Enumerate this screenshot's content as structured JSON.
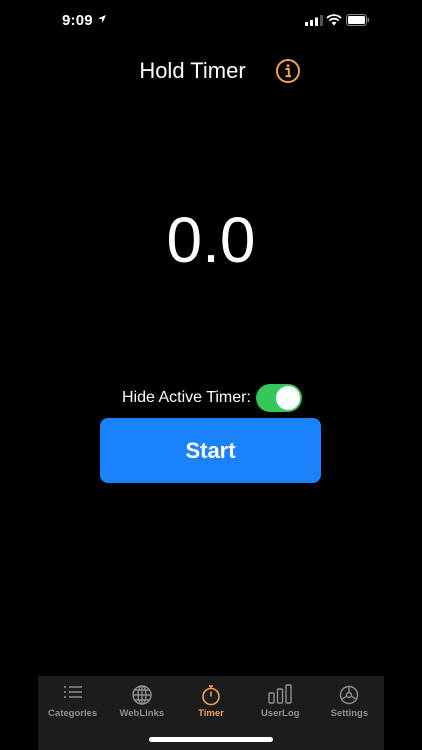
{
  "status_bar": {
    "time": "9:09"
  },
  "nav": {
    "title": "Hold Timer",
    "info_icon": "info-circle-icon"
  },
  "timer": {
    "display": "0.0"
  },
  "hide_timer": {
    "label": "Hide Active Timer:",
    "enabled": true
  },
  "start": {
    "label": "Start"
  },
  "tabs": [
    {
      "label": "Categories",
      "icon": "list-icon"
    },
    {
      "label": "WebLinks",
      "icon": "globe-icon"
    },
    {
      "label": "Timer",
      "icon": "stopwatch-icon",
      "active": true
    },
    {
      "label": "UserLog",
      "icon": "bars-icon"
    },
    {
      "label": "Settings",
      "icon": "gear-icon"
    }
  ],
  "colors": {
    "accent": "#f5a04a",
    "start_button": "#1a82fb",
    "toggle_on": "#34c759",
    "background": "#000000"
  }
}
